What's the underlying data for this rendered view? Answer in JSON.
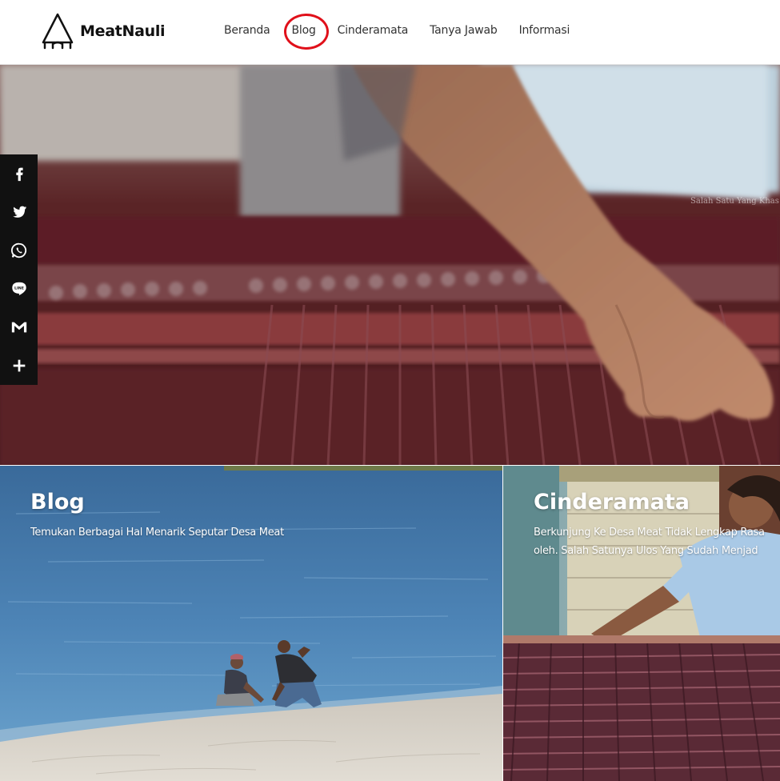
{
  "brand": {
    "name": "MeatNauli"
  },
  "nav": {
    "items": [
      {
        "label": "Beranda"
      },
      {
        "label": "Blog"
      },
      {
        "label": "Cinderamata"
      },
      {
        "label": "Tanya Jawab"
      },
      {
        "label": "Informasi"
      }
    ],
    "highlight_color": "#e0101a"
  },
  "hero": {
    "caption": "Salah Satu Yang Khas Da"
  },
  "share": {
    "buttons": [
      {
        "icon": "facebook-icon"
      },
      {
        "icon": "twitter-icon"
      },
      {
        "icon": "whatsapp-icon"
      },
      {
        "icon": "line-icon"
      },
      {
        "icon": "gmail-icon"
      },
      {
        "icon": "plus-icon"
      }
    ]
  },
  "cards": {
    "blog": {
      "title": "Blog",
      "description": "Temukan Berbagai Hal Menarik Seputar Desa Meat"
    },
    "cinderamata": {
      "title": "Cinderamata",
      "description_line1": "Berkunjung Ke Desa Meat Tidak Lengkap Rasa",
      "description_line2": "oleh. Salah Satunya Ulos Yang Sudah Menjad"
    }
  }
}
